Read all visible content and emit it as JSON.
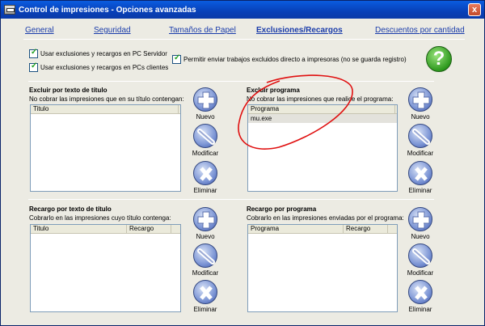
{
  "window": {
    "title": "Control de impresiones - Opciones avanzadas",
    "close_label": "x"
  },
  "tabs": [
    {
      "label": "General",
      "active": false
    },
    {
      "label": "Seguridad",
      "active": false
    },
    {
      "label": "Tamaños de Papel",
      "active": false
    },
    {
      "label": "Exclusiones/Recargos",
      "active": true
    },
    {
      "label": "Descuentos por cantidad",
      "active": false
    }
  ],
  "checkboxes": {
    "server": {
      "label": "Usar exclusiones y recargos en PC Servidor",
      "checked": true
    },
    "clients": {
      "label": "Usar exclusiones y recargos en PCs clientes",
      "checked": true
    },
    "direct": {
      "label": "Permitir enviar trabajos excluidos directo a impresoras (no se guarda registro)",
      "checked": true
    }
  },
  "help": {
    "glyph": "?"
  },
  "sections": {
    "exclude_title": {
      "title": "Excluir por texto de título",
      "subtitle": "No cobrar las impresiones que en su título contengan:",
      "columns": [
        "Titulo"
      ],
      "rows": []
    },
    "exclude_program": {
      "title": "Excluir programa",
      "subtitle": "No cobrar las impresiones que realice el programa:",
      "columns": [
        "Programa"
      ],
      "rows": [
        "mu.exe"
      ]
    },
    "surcharge_title": {
      "title": "Recargo por texto de título",
      "subtitle": "Cobrarlo en las impresiones cuyo título contenga:",
      "columns": [
        "Titulo",
        "Recargo"
      ],
      "rows": []
    },
    "surcharge_program": {
      "title": "Recargo por programa",
      "subtitle": "Cobrarlo en las impresiones enviadas por el programa:",
      "columns": [
        "Programa",
        "Recargo"
      ],
      "rows": []
    }
  },
  "actions": {
    "new": "Nuevo",
    "modify": "Modificar",
    "delete": "Eliminar"
  },
  "colors": {
    "accent_blue": "#1a3caa",
    "annotation_red": "#e01010",
    "help_green": "#2e9a1e"
  }
}
